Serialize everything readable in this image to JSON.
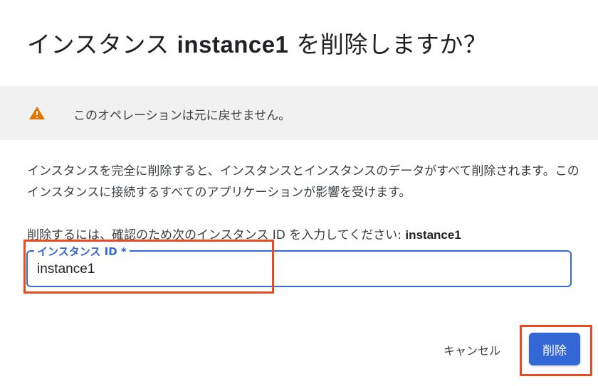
{
  "dialog": {
    "title_prefix": "インスタンス ",
    "title_instance": "instance1",
    "title_suffix": " を削除しますか？"
  },
  "warning": {
    "icon": "warning-triangle-icon",
    "text": "このオペレーションは元に戻せません。",
    "color": "#e37400"
  },
  "description": "インスタンスを完全に削除すると、インスタンスとインスタンスのデータがすべて削除されます。このインスタンスに接続するすべてのアプリケーションが影響を受けます。",
  "confirm": {
    "prompt": "削除するには、確認のため次のインスタンス ID を入力してください: ",
    "instance_id": "instance1"
  },
  "field": {
    "label": "インスタンス ID *",
    "value": "instance1"
  },
  "buttons": {
    "cancel": "キャンセル",
    "delete": "削除"
  },
  "colors": {
    "accent": "#3367d6",
    "highlight": "#ea4a22",
    "warning_bg": "#f1f1f1"
  }
}
